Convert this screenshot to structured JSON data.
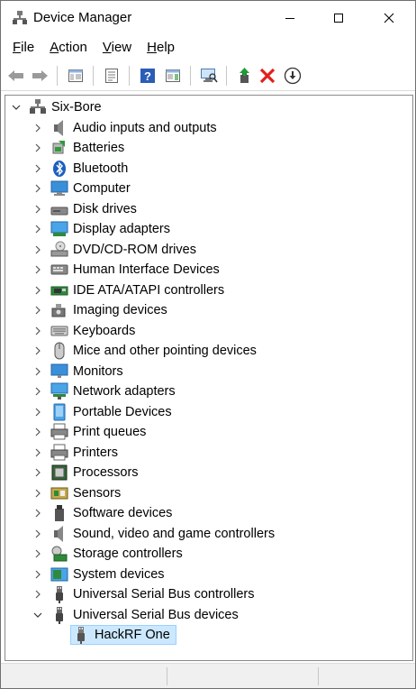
{
  "window": {
    "title": "Device Manager",
    "minimize_label": "",
    "maximize_label": "",
    "close_label": ""
  },
  "menu": [
    {
      "first": "F",
      "rest": "ile"
    },
    {
      "first": "A",
      "rest": "ction"
    },
    {
      "first": "V",
      "rest": "iew"
    },
    {
      "first": "H",
      "rest": "elp"
    }
  ],
  "toolbar": {
    "icons": [
      "back-icon",
      "forward-icon",
      "show-hide-console-tree-icon",
      "properties-icon",
      "help-icon",
      "action-pane-icon",
      "scan-hardware-icon",
      "update-driver-icon",
      "uninstall-icon",
      "disable-device-icon"
    ]
  },
  "tree": {
    "root": "Six-Bore",
    "categories": [
      {
        "label": "Audio inputs and outputs",
        "icon": "speaker-icon"
      },
      {
        "label": "Batteries",
        "icon": "battery-icon"
      },
      {
        "label": "Bluetooth",
        "icon": "bluetooth-icon"
      },
      {
        "label": "Computer",
        "icon": "computer-icon"
      },
      {
        "label": "Disk drives",
        "icon": "disk-drive-icon"
      },
      {
        "label": "Display adapters",
        "icon": "display-adapter-icon"
      },
      {
        "label": "DVD/CD-ROM drives",
        "icon": "dvd-drive-icon"
      },
      {
        "label": "Human Interface Devices",
        "icon": "hid-icon"
      },
      {
        "label": "IDE ATA/ATAPI controllers",
        "icon": "ide-controller-icon"
      },
      {
        "label": "Imaging devices",
        "icon": "camera-icon"
      },
      {
        "label": "Keyboards",
        "icon": "keyboard-icon"
      },
      {
        "label": "Mice and other pointing devices",
        "icon": "mouse-icon"
      },
      {
        "label": "Monitors",
        "icon": "monitor-icon"
      },
      {
        "label": "Network adapters",
        "icon": "network-adapter-icon"
      },
      {
        "label": "Portable Devices",
        "icon": "portable-device-icon"
      },
      {
        "label": "Print queues",
        "icon": "print-queue-icon"
      },
      {
        "label": "Printers",
        "icon": "printer-icon"
      },
      {
        "label": "Processors",
        "icon": "processor-icon"
      },
      {
        "label": "Sensors",
        "icon": "sensor-icon"
      },
      {
        "label": "Software devices",
        "icon": "software-device-icon"
      },
      {
        "label": "Sound, video and game controllers",
        "icon": "sound-controller-icon"
      },
      {
        "label": "Storage controllers",
        "icon": "storage-controller-icon"
      },
      {
        "label": "System devices",
        "icon": "system-device-icon"
      },
      {
        "label": "Universal Serial Bus controllers",
        "icon": "usb-icon"
      },
      {
        "label": "Universal Serial Bus devices",
        "icon": "usb-icon",
        "expanded": true
      }
    ],
    "child": {
      "label": "HackRF One",
      "icon": "usb-device-icon",
      "selected": true
    }
  },
  "colors": {
    "selection_bg": "#cce8ff",
    "selection_border": "#99d1ff",
    "accent_blue": "#1e73d2",
    "uninstall_red": "#e0201b",
    "update_green": "#1f9d3a"
  }
}
